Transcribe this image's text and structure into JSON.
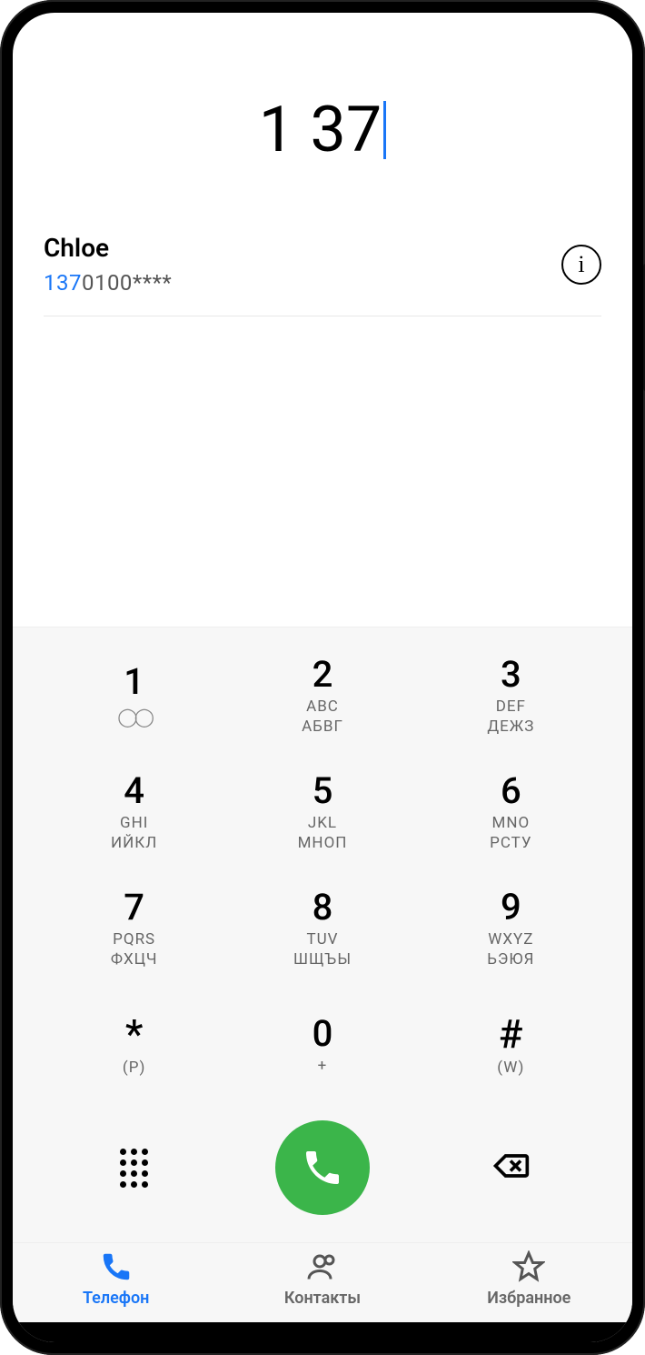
{
  "dialed_number": "1 37",
  "suggestion": {
    "name": "Chloe",
    "number_match": "137",
    "number_rest": "0100****"
  },
  "keys": [
    {
      "digit": "1",
      "sub1": "",
      "sub2": "",
      "voicemail": true
    },
    {
      "digit": "2",
      "sub1": "ABC",
      "sub2": "АБВГ"
    },
    {
      "digit": "3",
      "sub1": "DEF",
      "sub2": "ДЕЖЗ"
    },
    {
      "digit": "4",
      "sub1": "GHI",
      "sub2": "ИЙКЛ"
    },
    {
      "digit": "5",
      "sub1": "JKL",
      "sub2": "МНОП"
    },
    {
      "digit": "6",
      "sub1": "MNO",
      "sub2": "РСТУ"
    },
    {
      "digit": "7",
      "sub1": "PQRS",
      "sub2": "ФХЦЧ"
    },
    {
      "digit": "8",
      "sub1": "TUV",
      "sub2": "ШЩЪЫ"
    },
    {
      "digit": "9",
      "sub1": "WXYZ",
      "sub2": "ЬЭЮЯ"
    },
    {
      "digit": "*",
      "sub1": "(P)",
      "sub2": ""
    },
    {
      "digit": "0",
      "sub1": "+",
      "sub2": ""
    },
    {
      "digit": "#",
      "sub1": "(W)",
      "sub2": ""
    }
  ],
  "nav": {
    "phone": "Телефон",
    "contacts": "Контакты",
    "favorites": "Избранное"
  }
}
